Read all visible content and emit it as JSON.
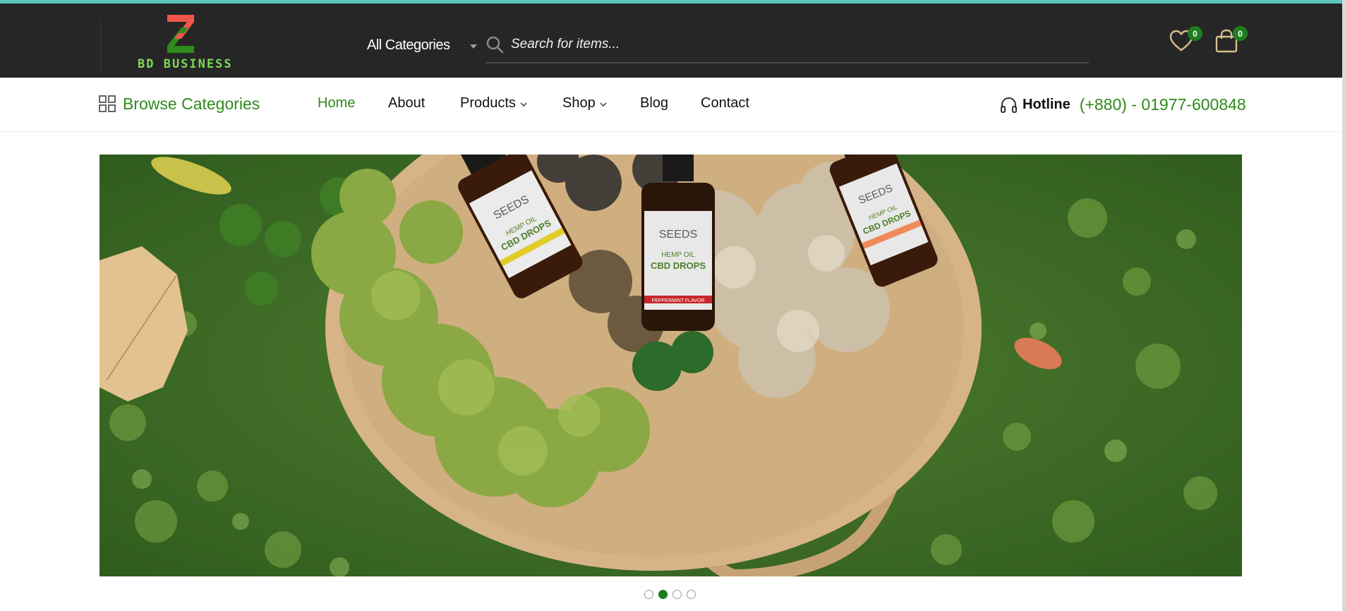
{
  "header": {
    "logo_text": "BD BUSINESS",
    "category_select": "All Categories",
    "search_placeholder": "Search for items...",
    "wishlist_count": "0",
    "cart_count": "0"
  },
  "nav": {
    "browse_label": "Browse Categories",
    "items": [
      {
        "label": "Home",
        "active": true
      },
      {
        "label": "About"
      },
      {
        "label": "Products",
        "dropdown": true
      },
      {
        "label": "Shop",
        "dropdown": true
      },
      {
        "label": "Blog"
      },
      {
        "label": "Contact"
      }
    ],
    "hotline_label": "Hotline",
    "hotline_number": "(+880) - 01977-600848"
  },
  "hero": {
    "bottle_left_brand": "SEEDS",
    "bottle_left_label": "CBD DROPS",
    "bottle_left_sub": "HEMP OIL",
    "bottle_center_brand": "SEEDS",
    "bottle_center_label": "CBD DROPS",
    "bottle_center_sub": "HEMP OIL",
    "bottle_center_flavor": "PEPPERMINT FLAVOR",
    "bottle_right_brand": "SEEDS",
    "bottle_right_label": "CBD DROPS",
    "bottle_right_sub": "HEMP OIL"
  },
  "slider": {
    "slide_count": 4,
    "active_index": 1
  },
  "colors": {
    "header_bg": "#262626",
    "accent_green": "#2f8a1c",
    "badge_green": "#1e7d1e",
    "icon_gold": "#d6c08a",
    "logo_red": "#f0564b",
    "logo_green": "#7ed957",
    "top_line": "#5cc6b8"
  },
  "icons": [
    "grid-icon",
    "search-icon",
    "heart-icon",
    "shopping-bag-icon",
    "headphones-icon",
    "chevron-down-icon"
  ]
}
